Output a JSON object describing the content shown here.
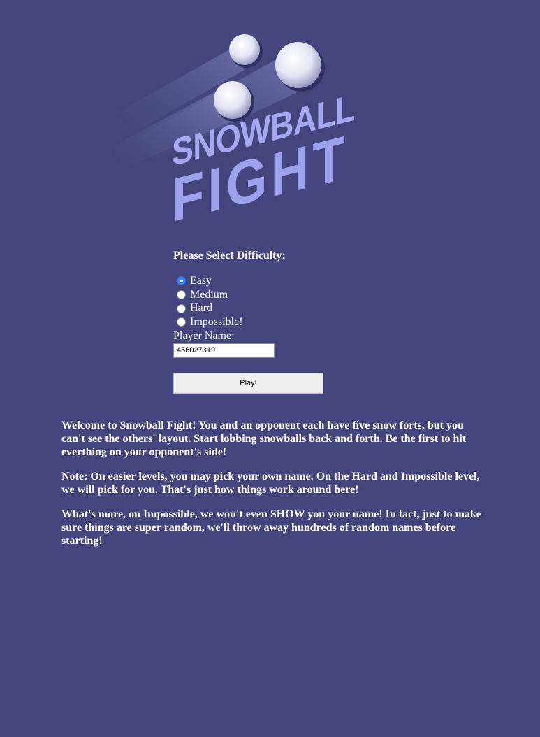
{
  "logo": {
    "line1": "SNOWBALL",
    "line2": "FIGHT",
    "text_color": "#a5a8f0"
  },
  "difficulty": {
    "heading": "Please Select Difficulty:",
    "options": [
      {
        "label": "Easy",
        "checked": true
      },
      {
        "label": "Medium",
        "checked": false
      },
      {
        "label": "Hard",
        "checked": false
      },
      {
        "label": "Impossible!",
        "checked": false
      }
    ]
  },
  "player": {
    "label": "Player Name:",
    "value": "456027319"
  },
  "play_button": {
    "label": "Play!"
  },
  "description": {
    "paragraphs": [
      "Welcome to Snowball Fight! You and an opponent each have five snow forts, but you can't see the others' layout. Start lobbing snowballs back and forth. Be the first to hit everthing on your opponent's side!",
      "Note: On easier levels, you may pick your own name. On the Hard and Impossible level, we will pick for you. That's just how things work around here!",
      "What's more, on Impossible, we won't even SHOW you your name! In fact, just to make sure things are super random, we'll throw away hundreds of random names before starting!"
    ]
  },
  "colors": {
    "background": "#43457c",
    "text": "#ffffff",
    "radio_checked": "#3b82f6"
  }
}
